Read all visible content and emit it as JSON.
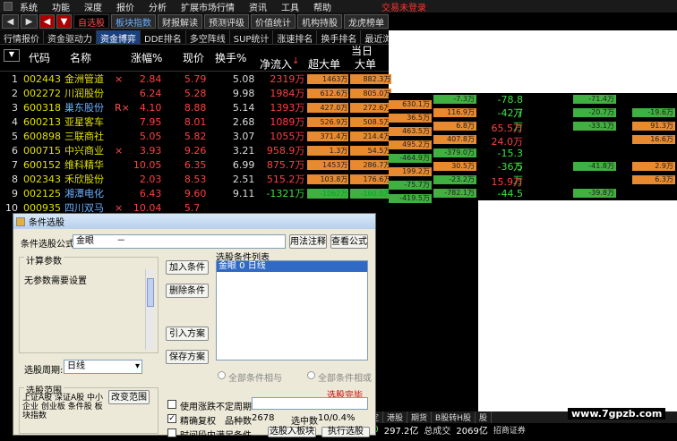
{
  "menu": {
    "items": [
      "系统",
      "功能",
      "深度",
      "报价",
      "分析",
      "扩展市场行情",
      "资讯",
      "工具",
      "帮助"
    ],
    "hot": "交易未登录"
  },
  "toolbar": {
    "buttons": [
      "◀",
      "▶",
      "◀",
      "▼",
      "自选股",
      "板块指数",
      "财报解读",
      "预测评级",
      "价值统计",
      "机构持股",
      "龙虎榜单"
    ]
  },
  "tabs": [
    "行情报价",
    "资金驱动力",
    "资金博弈",
    "DDE排名",
    "多空阵线",
    "SUP统计",
    "涨速排名",
    "换手排名",
    "最近浏览"
  ],
  "header": {
    "code": "代码",
    "name": "名称",
    "pct": "涨幅%",
    "price": "现价",
    "turnover": "换手%",
    "net": "净流入",
    "sup": "超大单",
    "big": "大单",
    "day": "当日"
  },
  "rows": [
    {
      "idx": "1",
      "code": "002443",
      "name": "金洲管道",
      "flag": "×",
      "pct": "2.84",
      "price": "5.79",
      "turn": "5.08",
      "net": "2319万",
      "b1": "1463万",
      "b2": "882.3万",
      "pctClass": "up",
      "netClass": "up"
    },
    {
      "idx": "2",
      "code": "002272",
      "name": "川润股份",
      "flag": "",
      "pct": "6.24",
      "price": "5.28",
      "turn": "9.98",
      "net": "1984万",
      "b1": "612.6万",
      "b2": "805.0万",
      "pctClass": "up",
      "netClass": "up"
    },
    {
      "idx": "3",
      "code": "600318",
      "name": "巢东股份",
      "flag": "R×",
      "pct": "4.10",
      "price": "8.88",
      "turn": "5.14",
      "net": "1393万",
      "b1": "427.0万",
      "b2": "272.6万",
      "pctClass": "up",
      "netClass": "up",
      "nameClass": "b"
    },
    {
      "idx": "4",
      "code": "600213",
      "name": "亚星客车",
      "flag": "",
      "pct": "7.95",
      "price": "8.01",
      "turn": "2.68",
      "net": "1089万",
      "b1": "526.9万",
      "b2": "508.5万",
      "pctClass": "up",
      "netClass": "up"
    },
    {
      "idx": "5",
      "code": "600898",
      "name": "三联商社",
      "flag": "",
      "pct": "5.05",
      "price": "5.82",
      "turn": "3.07",
      "net": "1055万",
      "b1": "371.4万",
      "b2": "214.4万",
      "pctClass": "up",
      "netClass": "up"
    },
    {
      "idx": "6",
      "code": "000715",
      "name": "中兴商业",
      "flag": "×",
      "pct": "3.93",
      "price": "9.26",
      "turn": "3.21",
      "net": "958.9万",
      "b1": "1.3万",
      "b2": "54.5万",
      "pctClass": "up",
      "netClass": "up"
    },
    {
      "idx": "7",
      "code": "600152",
      "name": "维科精华",
      "flag": "",
      "pct": "10.05",
      "price": "6.35",
      "turn": "6.99",
      "net": "875.7万",
      "b1": "1453万",
      "b2": "286.7万",
      "pctClass": "up",
      "netClass": "up"
    },
    {
      "idx": "8",
      "code": "002343",
      "name": "禾欣股份",
      "flag": "",
      "pct": "2.03",
      "price": "8.53",
      "turn": "2.51",
      "net": "515.2万",
      "b1": "103.8万",
      "b2": "176.6万",
      "pctClass": "up",
      "netClass": "up"
    },
    {
      "idx": "9",
      "code": "002125",
      "name": "湘潭电化",
      "flag": "",
      "pct": "6.43",
      "price": "9.60",
      "turn": "9.11",
      "net": "-1321万",
      "b1": "-1062万",
      "b2": "-160.0万",
      "pctClass": "up",
      "netClass": "dn",
      "nameClass": "b"
    },
    {
      "idx": "10",
      "code": "000935",
      "name": "四川双马",
      "flag": "×",
      "pct": "10.04",
      "price": "5.70",
      "turn": "13.19",
      "net": "-1644万",
      "b1": "201.2万",
      "b2": "-643.9万",
      "pctClass": "up",
      "netClass": "dn",
      "nameClass": "b"
    }
  ],
  "right_panel": [
    {
      "c1": "",
      "c2": "",
      "v": "",
      "c3": "",
      "c4": ""
    },
    {
      "c1": "-7.3万",
      "c2": "-",
      "v": "-78.8万",
      "c3": "-71.4万",
      "c4": ""
    },
    {
      "c1": "116.9万",
      "c2": "",
      "v": "-42.7万",
      "c3": "-20.7万",
      "c4": "-19.6万"
    },
    {
      "c1": "6.8万",
      "c2": "",
      "v": "65.5万",
      "c3": "-33.1万",
      "c4": "91.3万"
    },
    {
      "c1": "407.8万",
      "c2": "",
      "v": "24.0万",
      "c3": "",
      "c4": "16.6万"
    },
    {
      "c1": "-379.0万",
      "c2": "",
      "v": "-15.3万",
      "c3": "",
      "c4": ""
    },
    {
      "c1": "30.5万",
      "c2": "",
      "v": "-36.5万",
      "c3": "-41.8万",
      "c4": "2.9万"
    },
    {
      "c1": "-23.2万",
      "c2": "",
      "v": "15.9万",
      "c3": "",
      "c4": "6.3万"
    },
    {
      "c1": "-782.1万",
      "c2": "",
      "v": "-44.5万",
      "c3": "-39.8万",
      "c4": ""
    }
  ],
  "extra_cols": {
    "row3": [
      "630.1万"
    ],
    "row4": [
      "36.5万"
    ],
    "row5": [
      "463.5万"
    ],
    "row6": [
      "495.2万"
    ],
    "row7": [
      "-464.9万"
    ],
    "row8": [
      "199.2万"
    ],
    "row9": [
      "-75.7万"
    ],
    "row10": [
      "-419.5万"
    ]
  },
  "status": {
    "tabs": [
      "定",
      "港股",
      "期货",
      "B股转H股",
      "股"
    ],
    "v1": "70",
    "v2": "297.2亿",
    "v3": "总成交",
    "v4": "2069亿",
    "v5": "招商证券"
  },
  "watermark": "www.7gpzb.com",
  "dialog": {
    "title": "条件选股",
    "formula_label": "条件选股公式",
    "formula_value": "金眼",
    "formula_dash": "－",
    "btn_usage": "用法注释",
    "btn_view": "查看公式",
    "params_title": "计算参数",
    "params_text": "无参数需要设置",
    "btn_add": "加入条件",
    "btn_del": "删除条件",
    "btn_import": "引入方案",
    "btn_save": "保存方案",
    "list_title": "选股条件列表",
    "list_item": "金眼  0  日线",
    "period_label": "选股周期:",
    "period_value": "日线",
    "radio_and": "全部条件相与",
    "radio_or": "全部条件相或",
    "done_text": "选股完毕",
    "range_title": "选股范围",
    "range_text": "上证A股 深证A股 中小企业 创业板 条件股 板块指数",
    "btn_range": "改变范围",
    "chk_complex": "使用涨跌不定周期",
    "chk_precise": "精确复权",
    "count_label": "品种数",
    "count_value": "2678",
    "selected_label": "选中数",
    "selected_value": "10/0.4%",
    "chk_period": "时间段内满足条件",
    "btn_to_block": "选股入板块",
    "btn_run": "执行选股"
  }
}
